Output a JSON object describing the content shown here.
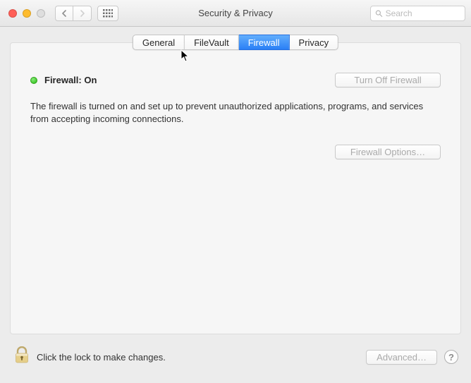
{
  "window": {
    "title": "Security & Privacy"
  },
  "search": {
    "placeholder": "Search"
  },
  "tabs": {
    "general": "General",
    "filevault": "FileVault",
    "firewall": "Firewall",
    "privacy": "Privacy",
    "active": "firewall"
  },
  "firewall": {
    "status_label": "Firewall: On",
    "turn_off_label": "Turn Off Firewall",
    "description": "The firewall is turned on and set up to prevent unauthorized applications, programs, and services from accepting incoming connections.",
    "options_label": "Firewall Options…"
  },
  "footer": {
    "lock_text": "Click the lock to make changes.",
    "advanced_label": "Advanced…",
    "help_label": "?"
  },
  "colors": {
    "accent": "#2a7ff6",
    "status_green": "#26bb11"
  }
}
